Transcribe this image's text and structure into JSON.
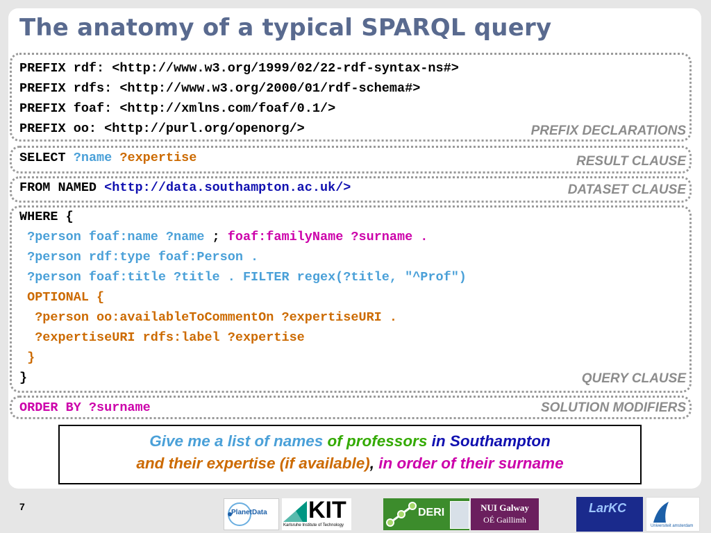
{
  "title": "The anatomy of a typical SPARQL query",
  "prefix": {
    "lines": [
      "PREFIX rdf: <http://www.w3.org/1999/02/22-rdf-syntax-ns#>",
      "PREFIX rdfs: <http://www.w3.org/2000/01/rdf-schema#>",
      "PREFIX foaf: <http://xmlns.com/foaf/0.1/>",
      "PREFIX oo: <http://purl.org/openorg/>"
    ],
    "label": "PREFIX DECLARATIONS"
  },
  "result": {
    "keyword": "SELECT",
    "var1": "?name",
    "var2": "?expertise",
    "label": "RESULT CLAUSE"
  },
  "dataset": {
    "keyword": "FROM NAMED",
    "uri": "<http://data.southampton.ac.uk/>",
    "label": "DATASET CLAUSE"
  },
  "query": {
    "open": "WHERE {",
    "l1a": " ?person foaf:name ?name",
    "l1b": " ; ",
    "l1c": "foaf:familyName ?surname .",
    "l2": " ?person rdf:type foaf:Person .",
    "l3": " ?person foaf:title ?title . FILTER regex(?title, \"^Prof\")",
    "l4": " OPTIONAL {",
    "l5": "  ?person oo:availableToCommentOn ?expertiseURI .",
    "l6": "  ?expertiseURI rdfs:label ?expertise",
    "l7": " }",
    "close": "}",
    "label": "QUERY CLAUSE"
  },
  "modifiers": {
    "code": "ORDER BY ?surname",
    "label": "SOLUTION MODIFIERS"
  },
  "caption": {
    "p1": "Give me a list of names",
    "p2": " of professors",
    "p3": " in Southampton",
    "p4": "and their expertise (if available)",
    "p5": ", ",
    "p6": "in order of their surname"
  },
  "page_number": "7",
  "logos": {
    "planetdata": "PlanetData",
    "kit": "KIT",
    "kit_sub": "Karlsruhe Institute of Technology",
    "deri": "DERI",
    "nui1": "NUI Galway",
    "nui2": "OÉ Gaillimh",
    "larkc": "LarKC",
    "vu": "Universiteit amsterdam"
  },
  "colors": {
    "title": "#596a8f",
    "var_blue": "#4aa0d8",
    "orange": "#cc6a00",
    "magenta": "#cc00aa",
    "dark_blue": "#1010b0",
    "green": "#33aa00"
  }
}
